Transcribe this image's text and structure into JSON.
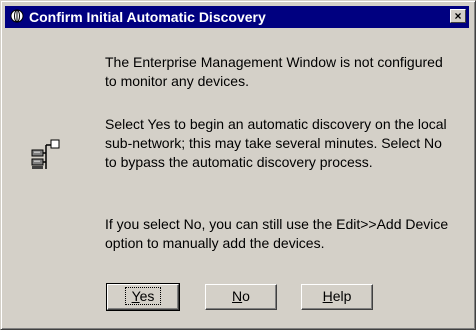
{
  "window": {
    "title": "Confirm Initial Automatic Discovery",
    "close_label": "×"
  },
  "message": {
    "paragraph1": "The Enterprise Management Window is not configured to monitor any devices.",
    "paragraph2": "Select Yes to begin an automatic discovery on the local sub-network; this may take several minutes. Select No to bypass the automatic discovery process.",
    "paragraph3": "If you select No, you can still use the Edit>>Add Device option to manually add the devices."
  },
  "buttons": {
    "yes": {
      "mnemonic": "Y",
      "rest": "es"
    },
    "no": {
      "mnemonic": "N",
      "rest": "o"
    },
    "help": {
      "mnemonic": "H",
      "rest": "elp"
    }
  },
  "icons": {
    "title": "globe-icon",
    "content": "network-devices-icon"
  }
}
